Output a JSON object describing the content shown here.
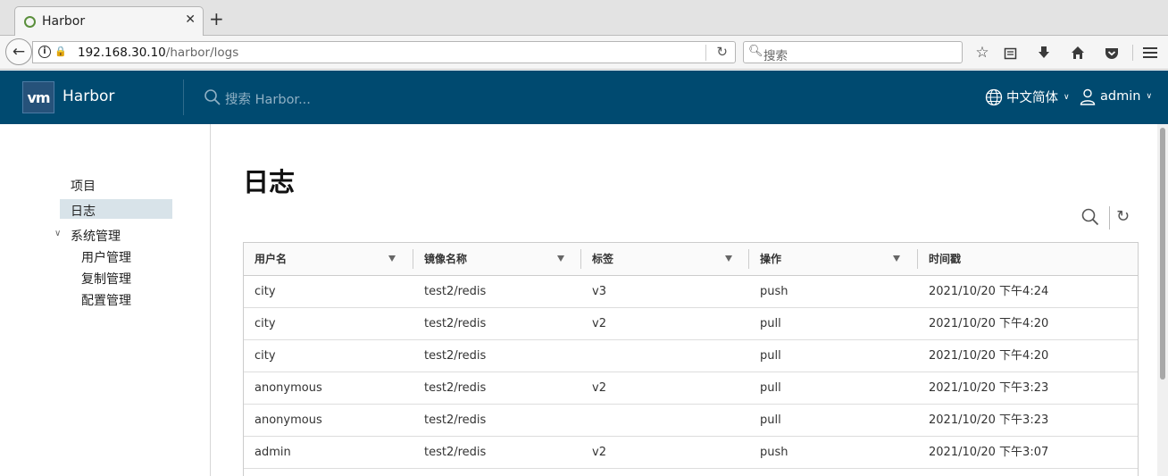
{
  "browser": {
    "tab_title": "Harbor",
    "tab_close": "✕",
    "new_tab": "+",
    "url_host": "192.168.30.10",
    "url_path": "/harbor/logs",
    "search_placeholder": "搜索"
  },
  "header": {
    "logo_text": "vm",
    "app_name": "Harbor",
    "search_placeholder": "搜索 Harbor...",
    "language": "中文简体",
    "user": "admin",
    "brand_color": "#004a70"
  },
  "sidebar": {
    "items": [
      {
        "label": "项目"
      },
      {
        "label": "日志",
        "active": true
      },
      {
        "label": "系统管理",
        "expanded": true
      }
    ],
    "admin_items": [
      {
        "label": "用户管理"
      },
      {
        "label": "复制管理"
      },
      {
        "label": "配置管理"
      }
    ]
  },
  "main": {
    "title": "日志",
    "columns": [
      "用户名",
      "镜像名称",
      "标签",
      "操作",
      "时间戳"
    ],
    "rows": [
      [
        "city",
        "test2/redis",
        "v3",
        "push",
        "2021/10/20 下午4:24"
      ],
      [
        "city",
        "test2/redis",
        "v2",
        "pull",
        "2021/10/20 下午4:20"
      ],
      [
        "city",
        "test2/redis",
        "",
        "pull",
        "2021/10/20 下午4:20"
      ],
      [
        "anonymous",
        "test2/redis",
        "v2",
        "pull",
        "2021/10/20 下午3:23"
      ],
      [
        "anonymous",
        "test2/redis",
        "",
        "pull",
        "2021/10/20 下午3:23"
      ],
      [
        "admin",
        "test2/redis",
        "v2",
        "push",
        "2021/10/20 下午3:07"
      ]
    ]
  }
}
